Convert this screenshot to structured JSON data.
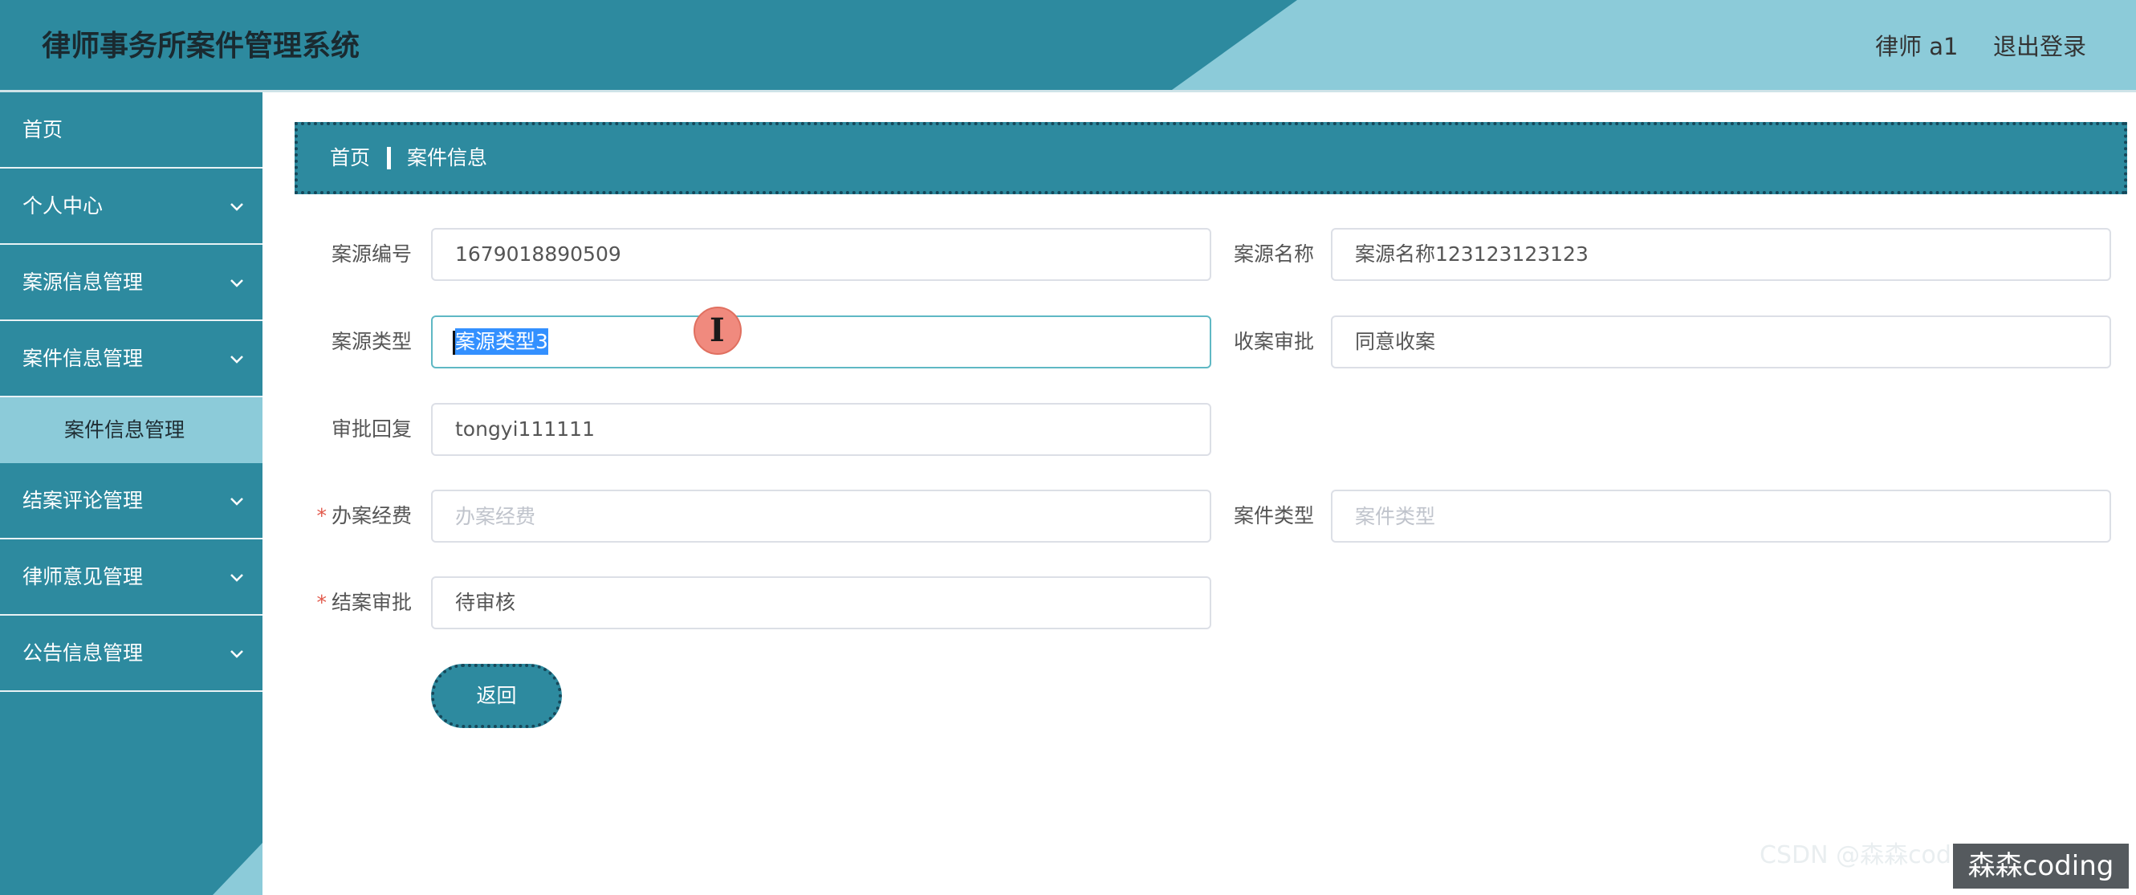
{
  "header": {
    "title": "律师事务所案件管理系统",
    "user": "律师 a1",
    "logout": "退出登录"
  },
  "sidebar": {
    "items": [
      {
        "label": "首页",
        "has_arrow": false
      },
      {
        "label": "个人中心",
        "has_arrow": true
      },
      {
        "label": "案源信息管理",
        "has_arrow": true
      },
      {
        "label": "案件信息管理",
        "has_arrow": true,
        "expanded": true
      },
      {
        "label": "结案评论管理",
        "has_arrow": true
      },
      {
        "label": "律师意见管理",
        "has_arrow": true
      },
      {
        "label": "公告信息管理",
        "has_arrow": true
      }
    ],
    "sub_item": "案件信息管理"
  },
  "breadcrumb": {
    "home": "首页",
    "current": "案件信息"
  },
  "form": {
    "source_no": {
      "label": "案源编号",
      "value": "1679018890509"
    },
    "source_name": {
      "label": "案源名称",
      "value": "案源名称123123123123"
    },
    "source_type": {
      "label": "案源类型",
      "value": "案源类型3"
    },
    "approval": {
      "label": "收案审批",
      "value": "同意收案"
    },
    "reply": {
      "label": "审批回复",
      "value": "tongyi111111"
    },
    "fee": {
      "label": "办案经费",
      "placeholder": "办案经费",
      "required": "*"
    },
    "case_type": {
      "label": "案件类型",
      "placeholder": "案件类型"
    },
    "close_approval": {
      "label": "结案审批",
      "value": "待审核",
      "required": "*"
    }
  },
  "back_button": "返回",
  "watermark": {
    "faint": "CSDN @森森coding",
    "badge": "森森coding"
  },
  "colors": {
    "primary": "#2d8a9f",
    "accent_light": "#8ccbd9",
    "selection": "#3390ff",
    "required": "#e25a4c"
  }
}
